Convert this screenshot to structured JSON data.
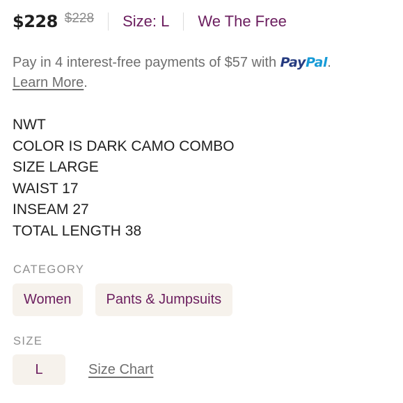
{
  "header": {
    "price": "$228",
    "original_price": "$228",
    "size_label": "Size: L",
    "brand": "We The Free"
  },
  "payment": {
    "text_before": "Pay in 4 interest-free payments of $57 with ",
    "paypal_part1": "Pay",
    "paypal_part2": "Pal",
    "text_after": ".",
    "learn_more": "Learn More",
    "learn_more_after": "."
  },
  "description": {
    "lines": [
      "NWT",
      "COLOR IS DARK CAMO COMBO",
      "SIZE LARGE",
      "WAIST 17",
      "INSEAM 27",
      "TOTAL LENGTH 38"
    ]
  },
  "category": {
    "label": "CATEGORY",
    "items": [
      "Women",
      "Pants & Jumpsuits"
    ]
  },
  "size": {
    "label": "SIZE",
    "value": "L",
    "chart_link": "Size Chart"
  },
  "colors": {
    "accent": "#6b1d5e",
    "chip_bg": "#f6f2ec",
    "muted_text": "#6e6e6e",
    "paypal_dark": "#253b80",
    "paypal_light": "#179bd7"
  }
}
